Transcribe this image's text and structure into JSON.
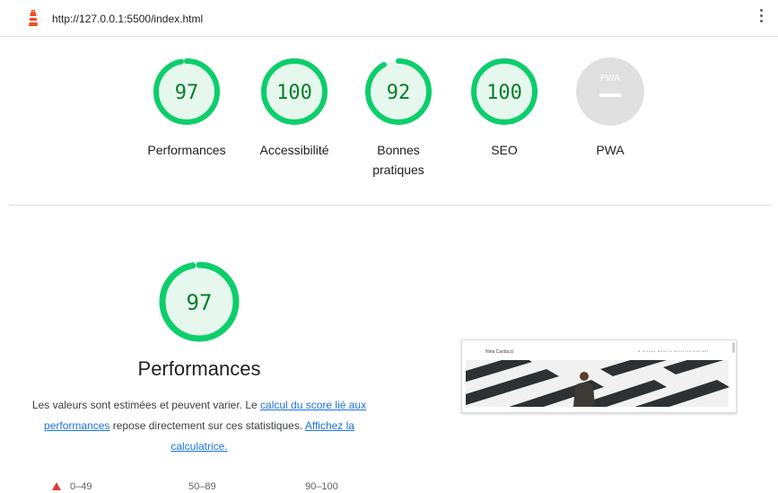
{
  "topbar": {
    "url": "http://127.0.0.1:5500/index.html"
  },
  "gauges": [
    {
      "score": 97,
      "score_text": "97",
      "label": "Performances"
    },
    {
      "score": 100,
      "score_text": "100",
      "label": "Accessibilité"
    },
    {
      "score": 92,
      "score_text": "92",
      "label_line1": "Bonnes",
      "label_line2": "pratiques"
    },
    {
      "score": 100,
      "score_text": "100",
      "label": "SEO"
    },
    {
      "badge_text": "PWA",
      "label": "PWA"
    }
  ],
  "performance": {
    "score": 97,
    "score_text": "97",
    "title": "Performances",
    "desc_part1": "Les valeurs sont estimées et peuvent varier. Le ",
    "link_calc": "calcul du score lié aux performances",
    "desc_part2": " repose directement sur ces statistiques. ",
    "link_calculator": "Affichez la calculatrice.",
    "legend": [
      "0–49",
      "50–89",
      "90–100"
    ]
  },
  "screenshot": {
    "site_name": "Nina Carducci",
    "nav": "À propos  Galerie  Services  Contact"
  },
  "colors": {
    "pass": "#0cce6b",
    "pass_fill": "#e6f8ee",
    "pass_text": "#0a7c2c",
    "fail": "#e53935",
    "pwa_gray": "#e0e0e0"
  }
}
